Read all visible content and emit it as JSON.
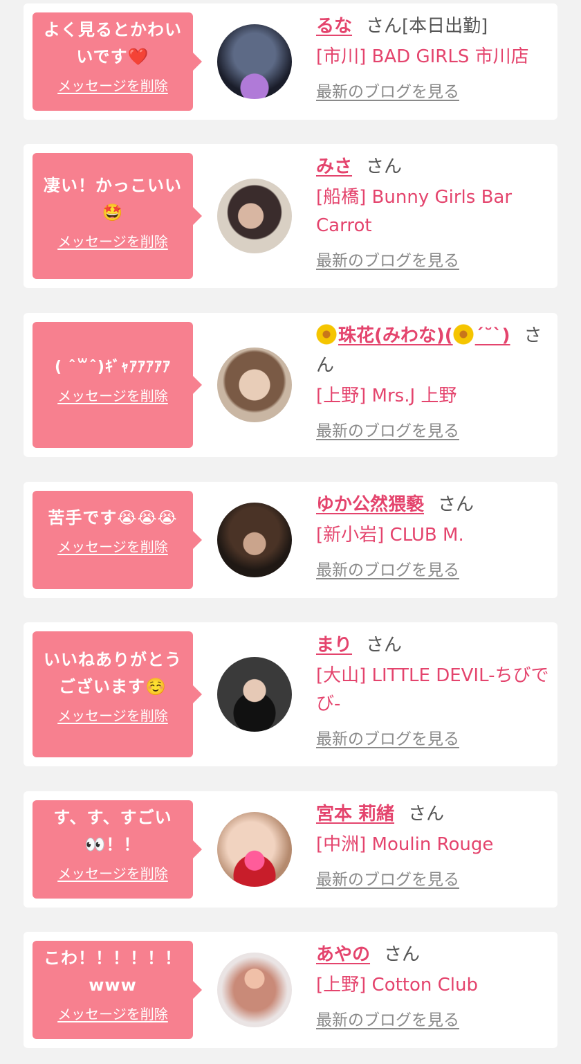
{
  "delete_label": "メッセージを削除",
  "blog_label": "最新のブログを見る",
  "honorific": "さん",
  "entries": [
    {
      "message": "よく見るとかわい\nいです❤️",
      "name": "るな",
      "status": "[本日出勤]",
      "shop": "[市川] BAD GIRLS 市川店"
    },
    {
      "message": "凄い！かっこいい\n🤩",
      "name": "みさ",
      "status": "",
      "shop": "[船橋] Bunny Girls Bar Carrot"
    },
    {
      "message": "( ˆ꒳ˆ)ｷﾞｬｱｱｱｱｱ",
      "name_parts": [
        "珠花(みわな)(",
        "ˊ˘ˋ)"
      ],
      "name": "🌼珠花(みわな)(🌼ˊ˘ˋ)",
      "status": "",
      "shop": "[上野] Mrs.J 上野"
    },
    {
      "message": "苦手です😭😭😭",
      "name": "ゆか公然猥褻",
      "status": "",
      "shop": "[新小岩] CLUB M."
    },
    {
      "message": "いいねありがとう\nございます☺️",
      "name": "まり",
      "status": "",
      "shop": "[大山] LITTLE DEVIL-ちびでび-"
    },
    {
      "message": "す、す、すごい\n👀！！",
      "name": "宮本 莉緒",
      "status": "",
      "shop": "[中洲] Moulin Rouge"
    },
    {
      "message": "こわ！！！！！！\nwww",
      "name": "あやの",
      "status": "",
      "shop": "[上野] Cotton Club"
    }
  ],
  "colors": {
    "background": "#f2f2f2",
    "card": "#ffffff",
    "bubble": "#f7808f",
    "name_pink": "#e4446d",
    "link_gray": "#8a8a8a"
  }
}
